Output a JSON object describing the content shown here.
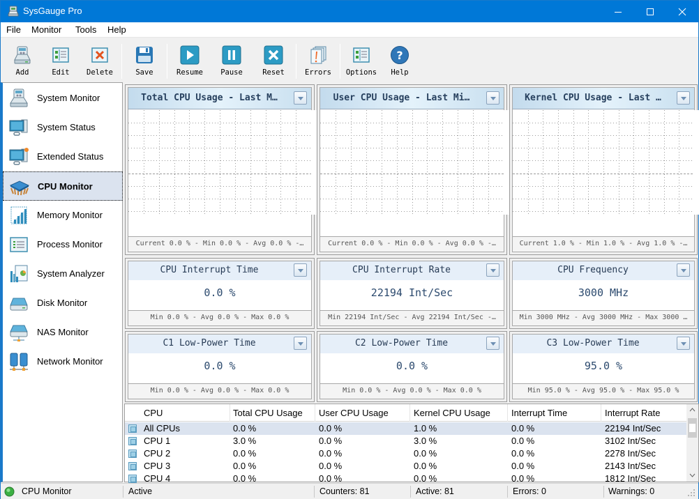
{
  "window": {
    "title": "SysGauge Pro",
    "controls": {
      "minimize": "minimize-icon",
      "maximize": "maximize-icon",
      "close": "close-icon"
    }
  },
  "menu": [
    "File",
    "Monitor",
    "Tools",
    "Help"
  ],
  "toolbar": {
    "buttons": [
      {
        "label": "Add",
        "icon": "add-drive-icon"
      },
      {
        "label": "Edit",
        "icon": "edit-list-icon"
      },
      {
        "label": "Delete",
        "icon": "delete-icon"
      },
      {
        "label": "Save",
        "icon": "floppy-disk-icon"
      },
      {
        "label": "Resume",
        "icon": "play-icon"
      },
      {
        "label": "Pause",
        "icon": "pause-icon"
      },
      {
        "label": "Reset",
        "icon": "reset-x-icon"
      },
      {
        "label": "Errors",
        "icon": "errors-icon"
      },
      {
        "label": "Options",
        "icon": "options-icon"
      },
      {
        "label": "Help",
        "icon": "help-icon"
      }
    ]
  },
  "sidebar": {
    "items": [
      {
        "label": "System Monitor",
        "icon": "system-monitor-icon",
        "selected": false
      },
      {
        "label": "System Status",
        "icon": "computer-icon",
        "selected": false
      },
      {
        "label": "Extended Status",
        "icon": "computer-alert-icon",
        "selected": false
      },
      {
        "label": "CPU Monitor",
        "icon": "cpu-chip-icon",
        "selected": true
      },
      {
        "label": "Memory Monitor",
        "icon": "memory-chart-icon",
        "selected": false
      },
      {
        "label": "Process Monitor",
        "icon": "process-list-icon",
        "selected": false
      },
      {
        "label": "System Analyzer",
        "icon": "analyzer-icon",
        "selected": false
      },
      {
        "label": "Disk Monitor",
        "icon": "disk-icon",
        "selected": false
      },
      {
        "label": "NAS Monitor",
        "icon": "nas-icon",
        "selected": false
      },
      {
        "label": "Network Monitor",
        "icon": "network-icon",
        "selected": false
      }
    ]
  },
  "charts": [
    {
      "title": "Total CPU Usage - Last M…",
      "footer": "Current 0.0 % - Min 0.0 % - Avg 0.0 % -…"
    },
    {
      "title": "User CPU Usage - Last Mi…",
      "footer": "Current 0.0 % - Min 0.0 % - Avg 0.0 % -…"
    },
    {
      "title": "Kernel CPU Usage - Last …",
      "footer": "Current 1.0 % - Min 1.0 % - Avg 1.0 % -…"
    }
  ],
  "gauges": [
    {
      "title": "CPU Interrupt Time",
      "value": "0.0 %",
      "footer": "Min 0.0 % - Avg 0.0 % - Max 0.0 %"
    },
    {
      "title": "CPU Interrupt Rate",
      "value": "22194 Int/Sec",
      "footer": "Min 22194 Int/Sec - Avg 22194 Int/Sec -…"
    },
    {
      "title": "CPU Frequency",
      "value": "3000 MHz",
      "footer": "Min 3000 MHz - Avg 3000 MHz - Max 3000 …"
    },
    {
      "title": "C1 Low-Power Time",
      "value": "0.0 %",
      "footer": "Min 0.0 % - Avg 0.0 % - Max 0.0 %"
    },
    {
      "title": "C2 Low-Power Time",
      "value": "0.0 %",
      "footer": "Min 0.0 % - Avg 0.0 % - Max 0.0 %"
    },
    {
      "title": "C3 Low-Power Time",
      "value": "95.0 %",
      "footer": "Min 95.0 % - Avg 95.0 % - Max 95.0 %"
    }
  ],
  "table": {
    "columns": [
      "CPU",
      "Total CPU Usage",
      "User CPU Usage",
      "Kernel CPU Usage",
      "Interrupt Time",
      "Interrupt Rate"
    ],
    "rows": [
      [
        "All CPUs",
        "0.0 %",
        "0.0 %",
        "1.0 %",
        "0.0 %",
        "22194 Int/Sec"
      ],
      [
        "CPU 1",
        "3.0 %",
        "0.0 %",
        "3.0 %",
        "0.0 %",
        "3102 Int/Sec"
      ],
      [
        "CPU 2",
        "0.0 %",
        "0.0 %",
        "0.0 %",
        "0.0 %",
        "2278 Int/Sec"
      ],
      [
        "CPU 3",
        "0.0 %",
        "0.0 %",
        "0.0 %",
        "0.0 %",
        "2143 Int/Sec"
      ],
      [
        "CPU 4",
        "0.0 %",
        "0.0 %",
        "0.0 %",
        "0.0 %",
        "1812 Int/Sec"
      ]
    ],
    "selected_row": 0
  },
  "status": {
    "module": "CPU Monitor",
    "state": "Active",
    "counters": "Counters: 81",
    "active": "Active: 81",
    "errors": "Errors: 0",
    "warnings": "Warnings: 0",
    "indicator_color": "#3cb043"
  }
}
